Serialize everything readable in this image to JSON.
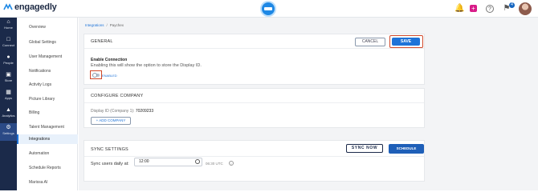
{
  "header": {
    "logo_text": "engagedly",
    "flag_badge": "4"
  },
  "leftnav": [
    {
      "label": "Home",
      "icon": "home-icon"
    },
    {
      "label": "Connect",
      "icon": "chat-icon"
    },
    {
      "label": "People",
      "icon": "people-icon"
    },
    {
      "label": "Store",
      "icon": "cart-icon"
    },
    {
      "label": "Apps",
      "icon": "apps-icon"
    },
    {
      "label": "Analytics",
      "icon": "analytics-icon"
    },
    {
      "label": "Settings",
      "icon": "gear-icon"
    }
  ],
  "sidebar": {
    "items": [
      {
        "label": "Overview"
      },
      {
        "label": "Global Settings"
      },
      {
        "label": "User Management"
      },
      {
        "label": "Notifications"
      },
      {
        "label": "Activity Logs"
      },
      {
        "label": "Picture Library"
      },
      {
        "label": "Billing"
      },
      {
        "label": "Talent Management"
      },
      {
        "label": "Integrations"
      },
      {
        "label": "Automation"
      },
      {
        "label": "Schedule Reports"
      },
      {
        "label": "Marissa AI"
      }
    ]
  },
  "breadcrumb": {
    "parent": "Integrations",
    "separator": "/",
    "current": "Paychex"
  },
  "general": {
    "title": "GENERAL",
    "cancel_label": "CANCEL",
    "save_label": "SAVE",
    "enable_title": "Enable Connection",
    "enable_desc": "Enabling this will show the option to store the Display ID.",
    "toggle_label": "ENABLED"
  },
  "configure": {
    "title": "CONFIGURE COMPANY",
    "display_id_label": "Display ID (Company 1):",
    "display_id_value": "70209233",
    "add_company_label": "+ ADD COMPANY"
  },
  "sync": {
    "title": "SYNC SETTINGS",
    "sync_now_label": "SYNC NOW",
    "schedule_label": "SCHEDULE",
    "daily_label": "Sync users daily at:",
    "time_value": "12:00",
    "utc_text": "06:30 UTC"
  },
  "colors": {
    "accent": "#1e73d8",
    "nav_bg": "#1b2a4a",
    "highlight_box": "#d0482a"
  }
}
